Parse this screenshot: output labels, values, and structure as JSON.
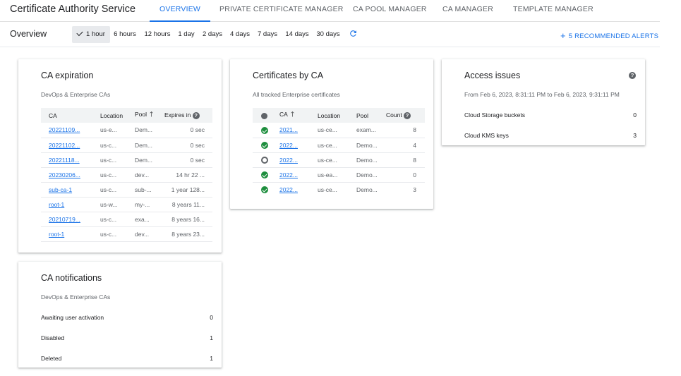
{
  "app": {
    "title": "Certificate Authority Service"
  },
  "tabs": [
    {
      "label": "OVERVIEW"
    },
    {
      "label": "PRIVATE CERTIFICATE MANAGER"
    },
    {
      "label": "CA POOL MANAGER"
    },
    {
      "label": "CA MANAGER"
    },
    {
      "label": "TEMPLATE MANAGER"
    }
  ],
  "overview": {
    "title": "Overview",
    "ranges": [
      "1 hour",
      "6 hours",
      "12 hours",
      "1 day",
      "2 days",
      "4 days",
      "7 days",
      "14 days",
      "30 days"
    ],
    "selected_range": "1 hour",
    "alerts_label": "5 RECOMMENDED ALERTS"
  },
  "ca_expiration": {
    "title": "CA expiration",
    "subtitle": "DevOps & Enterprise CAs",
    "columns": [
      "CA",
      "Location",
      "Pool",
      "Expires in"
    ],
    "rows": [
      [
        "20221109...",
        "us-e...",
        "Dem...",
        "0 sec"
      ],
      [
        "20221102...",
        "us-c...",
        "Dem...",
        "0 sec"
      ],
      [
        "20221118...",
        "us-c...",
        "Dem...",
        "0 sec"
      ],
      [
        "20230206...",
        "us-c...",
        "dev...",
        "14 hr 22 ..."
      ],
      [
        "sub-ca-1",
        "us-c...",
        "sub-...",
        "1 year 128..."
      ],
      [
        "root-1",
        "us-w...",
        "my-...",
        "8 years 11..."
      ],
      [
        "20210719...",
        "us-c...",
        "exa...",
        "8 years 16..."
      ],
      [
        "root-1",
        "us-c...",
        "dev...",
        "8 years 23..."
      ]
    ]
  },
  "certs_by_ca": {
    "title": "Certificates by CA",
    "subtitle": "All tracked Enterprise certificates",
    "columns": [
      "CA",
      "Location",
      "Pool",
      "Count"
    ],
    "rows": [
      {
        "status": "ok",
        "ca": "2021...",
        "location": "us-ce...",
        "pool": "exam...",
        "count": "8"
      },
      {
        "status": "ok",
        "ca": "2022...",
        "location": "us-ce...",
        "pool": "Demo...",
        "count": "4"
      },
      {
        "status": "pending",
        "ca": "2022...",
        "location": "us-ce...",
        "pool": "Demo...",
        "count": "8"
      },
      {
        "status": "ok",
        "ca": "2022...",
        "location": "us-ea...",
        "pool": "Demo...",
        "count": "0"
      },
      {
        "status": "ok",
        "ca": "2022...",
        "location": "us-ce...",
        "pool": "Demo...",
        "count": "3"
      }
    ]
  },
  "access_issues": {
    "title": "Access issues",
    "subtitle": "From Feb 6, 2023, 8:31:11 PM to Feb 6, 2023, 9:31:11 PM",
    "items": [
      {
        "label": "Cloud Storage buckets",
        "value": "0"
      },
      {
        "label": "Cloud KMS keys",
        "value": "3"
      }
    ]
  },
  "ca_notifications": {
    "title": "CA notifications",
    "subtitle": "DevOps & Enterprise CAs",
    "items": [
      {
        "label": "Awaiting user activation",
        "value": "0"
      },
      {
        "label": "Disabled",
        "value": "1"
      },
      {
        "label": "Deleted",
        "value": "1"
      }
    ]
  },
  "icons": {
    "help": "help-circle-icon",
    "refresh": "refresh-icon",
    "sort": "arrow-upward-icon",
    "status_ok": "check-circle-icon",
    "status_pending": "pending-circle-icon"
  },
  "colors": {
    "accent": "#1a73e8",
    "success": "#1e8e3e",
    "muted": "#5f6368"
  }
}
